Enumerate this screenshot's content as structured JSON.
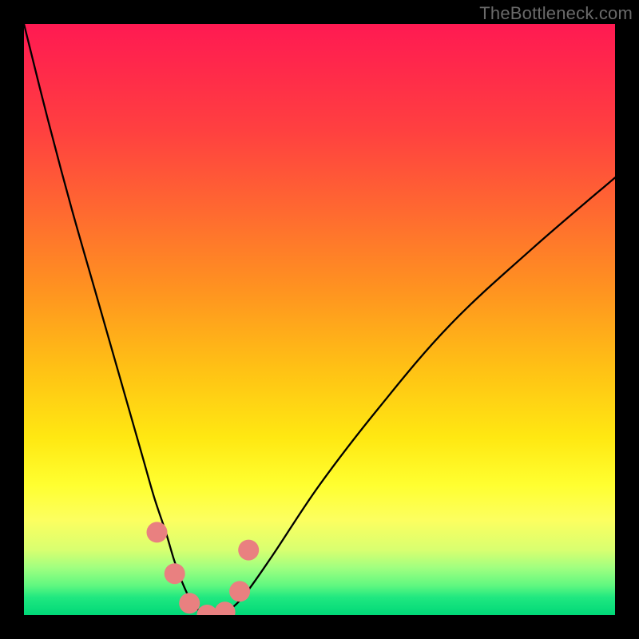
{
  "watermark": "TheBottleneck.com",
  "chart_data": {
    "type": "line",
    "title": "",
    "xlabel": "",
    "ylabel": "",
    "xlim": [
      0,
      100
    ],
    "ylim": [
      0,
      100
    ],
    "grid": false,
    "x": [
      0,
      4,
      8,
      12,
      16,
      20,
      22,
      24,
      25.5,
      27,
      28.5,
      30,
      32,
      34,
      37,
      42,
      50,
      60,
      72,
      86,
      100
    ],
    "values": [
      100,
      84,
      69,
      55,
      41,
      27,
      20,
      14,
      9,
      5,
      2,
      0.5,
      0,
      0.5,
      3,
      10,
      22,
      35,
      49,
      62,
      74
    ],
    "markers": {
      "color_hex": "#e98080",
      "points": [
        {
          "x": 22.5,
          "y": 14
        },
        {
          "x": 25.5,
          "y": 7
        },
        {
          "x": 28,
          "y": 2
        },
        {
          "x": 31,
          "y": 0
        },
        {
          "x": 34,
          "y": 0.5
        },
        {
          "x": 36.5,
          "y": 4
        },
        {
          "x": 38,
          "y": 11
        }
      ]
    },
    "gradient_stops": [
      {
        "pos": 0.0,
        "color": "#ff1a52"
      },
      {
        "pos": 0.45,
        "color": "#ff9320"
      },
      {
        "pos": 0.78,
        "color": "#ffff30"
      },
      {
        "pos": 1.0,
        "color": "#00d878"
      }
    ]
  }
}
